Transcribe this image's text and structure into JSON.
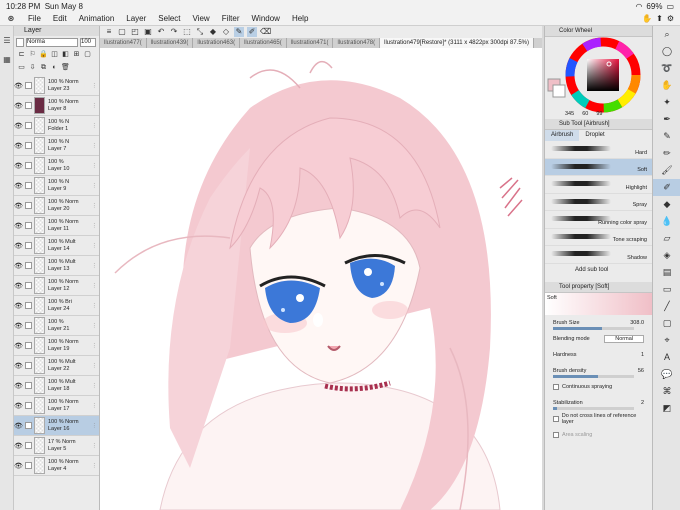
{
  "statusbar": {
    "time": "10:28 PM",
    "date": "Sun May 8",
    "battery": "69%"
  },
  "menu": {
    "items": [
      "File",
      "Edit",
      "Animation",
      "Layer",
      "Select",
      "View",
      "Filter",
      "Window",
      "Help"
    ]
  },
  "tabs": [
    "llustration477(",
    "llustration439(",
    "llustration463(",
    "llustration465(",
    "llustration471(",
    "llustration478(",
    "llustration479[Restore]* (3111 x 4822px 300dpi 87.5%)"
  ],
  "layer_panel": {
    "title": "Layer",
    "blend_mode": "Norma",
    "opacity": "100",
    "layers": [
      {
        "pct": "100 %",
        "mode": "Norm",
        "name": "Layer 23",
        "thumb": "plain",
        "selected": false
      },
      {
        "pct": "100 %",
        "mode": "Norm",
        "name": "Layer 8",
        "thumb": "dark",
        "selected": false
      },
      {
        "pct": "100 %",
        "mode": "N",
        "name": "Folder 1",
        "thumb": "plain",
        "selected": false
      },
      {
        "pct": "100 %",
        "mode": "N",
        "name": "Layer 7",
        "thumb": "plain",
        "selected": false
      },
      {
        "pct": "100 %",
        "mode": "",
        "name": "Layer 10",
        "thumb": "plain",
        "selected": false
      },
      {
        "pct": "100 %",
        "mode": "N",
        "name": "Layer 9",
        "thumb": "plain",
        "selected": false
      },
      {
        "pct": "100 %",
        "mode": "Norm",
        "name": "Layer 20",
        "thumb": "plain",
        "selected": false
      },
      {
        "pct": "100 %",
        "mode": "Norm",
        "name": "Layer 11",
        "thumb": "plain",
        "selected": false
      },
      {
        "pct": "100 %",
        "mode": "Mult",
        "name": "Layer 14",
        "thumb": "plain",
        "selected": false
      },
      {
        "pct": "100 %",
        "mode": "Mult",
        "name": "Layer 13",
        "thumb": "plain",
        "selected": false
      },
      {
        "pct": "100 %",
        "mode": "Norm",
        "name": "Layer 12",
        "thumb": "plain",
        "selected": false
      },
      {
        "pct": "100 %",
        "mode": "Bri",
        "name": "Layer 24",
        "thumb": "plain",
        "selected": false
      },
      {
        "pct": "100 %",
        "mode": "",
        "name": "Layer 21",
        "thumb": "plain",
        "selected": false
      },
      {
        "pct": "100 %",
        "mode": "Norm",
        "name": "Layer 19",
        "thumb": "plain",
        "selected": false
      },
      {
        "pct": "100 %",
        "mode": "Mult",
        "name": "Layer 22",
        "thumb": "plain",
        "selected": false
      },
      {
        "pct": "100 %",
        "mode": "Mult",
        "name": "Layer 18",
        "thumb": "plain",
        "selected": false
      },
      {
        "pct": "100 %",
        "mode": "Norm",
        "name": "Layer 17",
        "thumb": "plain",
        "selected": false
      },
      {
        "pct": "100 %",
        "mode": "Norm",
        "name": "Layer 16",
        "thumb": "plain",
        "selected": true
      },
      {
        "pct": "17 %",
        "mode": "Norm",
        "name": "Layer 5",
        "thumb": "plain",
        "selected": false
      },
      {
        "pct": "100 %",
        "mode": "Norm",
        "name": "Layer 4",
        "thumb": "plain",
        "selected": false
      }
    ]
  },
  "color_wheel": {
    "title": "Color Wheel",
    "h": "345",
    "s": "60",
    "v": "99",
    "main_color": "#f0bfc7"
  },
  "sub_tool": {
    "title": "Sub Tool [Airbrush]",
    "tabs": [
      "Airbrush",
      "Droplet"
    ],
    "brushes": [
      {
        "label": "Hard",
        "selected": false
      },
      {
        "label": "Soft",
        "selected": true
      },
      {
        "label": "Highlight",
        "selected": false
      },
      {
        "label": "Spray",
        "selected": false
      },
      {
        "label": "Running color spray",
        "selected": false
      },
      {
        "label": "Tone scraping",
        "selected": false
      },
      {
        "label": "Shadow",
        "selected": false
      }
    ],
    "add_label": "Add sub tool"
  },
  "tool_property": {
    "title": "Tool property [Soft]",
    "preset": "Soft",
    "brush_size_label": "Brush Size",
    "brush_size": "308.0",
    "brush_size_fraction": 0.6,
    "blending_label": "Blending mode",
    "blending_value": "Normal",
    "hardness_label": "Hardness",
    "hardness_value": "1",
    "density_label": "Brush density",
    "density_value": "56",
    "density_fraction": 0.56,
    "continuous_label": "Continuous spraying",
    "stabilization_label": "Stabilization",
    "stabilization_value": "2",
    "stabilization_fraction": 0.05,
    "cross_label": "Do not cross lines of reference layer",
    "area_label": "Area scaling"
  },
  "colors": {
    "accent": "#b8cde3",
    "hair_pink": "#f6cfd6",
    "eye_blue": "#3c78d8",
    "choker": "#a8304f"
  }
}
